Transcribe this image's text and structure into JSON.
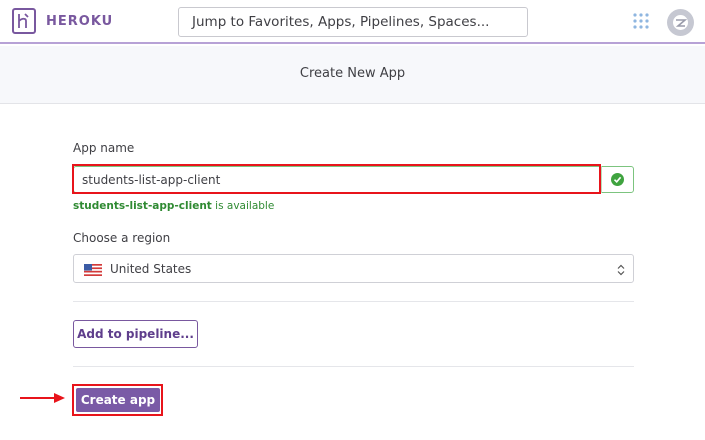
{
  "header": {
    "brand": "HEROKU",
    "search": {
      "placeholder": "Jump to Favorites, Apps, Pipelines, Spaces..."
    }
  },
  "page": {
    "title": "Create New App"
  },
  "form": {
    "app_name_label": "App name",
    "app_name_value": "students-list-app-client",
    "availability": {
      "name": "students-list-app-client",
      "status": "is available"
    },
    "region_label": "Choose a region",
    "region_value": "United States",
    "pipeline_button": "Add to pipeline...",
    "create_button": "Create app"
  },
  "colors": {
    "brand": "#79589f",
    "success": "#3fa33f",
    "highlight": "#e8141b",
    "primary_button": "#7a5aa6"
  },
  "icons": [
    "heroku-logo-icon",
    "apps-grid-icon",
    "avatar-icon",
    "check-circle-icon",
    "us-flag-icon",
    "chevron-updown-icon",
    "red-arrow-icon"
  ]
}
